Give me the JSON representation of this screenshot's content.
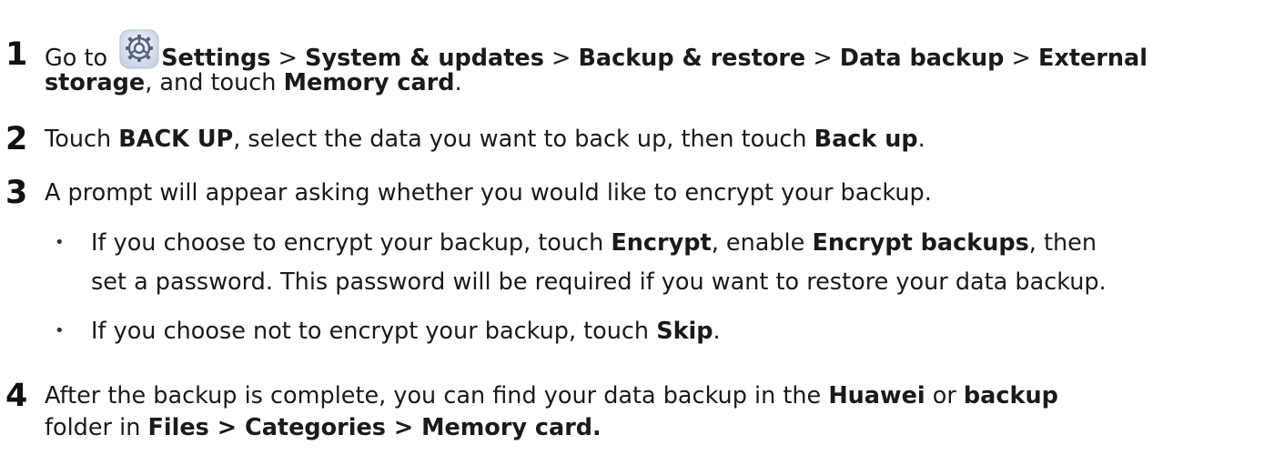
{
  "steps": [
    {
      "number": "1",
      "line1": {
        "t1": "Go to ",
        "icon": "settings-gear-icon",
        "b1": "Settings",
        "t2": " > ",
        "b2": "System & updates",
        "t3": " > ",
        "b3": "Backup & restore",
        "t4": " > ",
        "b4": "Data backup",
        "t5": " > ",
        "b5": "External"
      },
      "line2": {
        "b1": "storage",
        "t1": ", and touch ",
        "b2": "Memory card",
        "t2": "."
      }
    },
    {
      "number": "2",
      "line1": {
        "t1": "Touch ",
        "b1": "BACK UP",
        "t2": ", select the data you want to back up, then touch ",
        "b2": "Back up",
        "t3": "."
      }
    },
    {
      "number": "3",
      "line1": {
        "t1": "A prompt will appear asking whether you would like to encrypt your backup."
      },
      "bullets": [
        {
          "line1": {
            "t1": "If you choose to encrypt your backup, touch ",
            "b1": "Encrypt",
            "t2": ", enable ",
            "b2": "Encrypt backups",
            "t3": ", then"
          },
          "line2": "set a password. This password will be required if you want to restore your data backup."
        },
        {
          "line1": {
            "t1": "If you choose not to encrypt your backup, touch ",
            "b1": "Skip",
            "t2": "."
          }
        }
      ]
    },
    {
      "number": "4",
      "line1": {
        "t1": "After the backup is complete, you can find your data backup in the ",
        "b1": "Huawei",
        "t2": " or ",
        "b2": "backup"
      },
      "line2": {
        "t1": "folder in ",
        "b1": "Files > Categories > Memory card."
      }
    }
  ],
  "bullet_glyph": "•",
  "colors": {
    "text": "#1a1a1a",
    "icon_ring": "#5a6b8c",
    "icon_bg": "#e6ecf5"
  }
}
